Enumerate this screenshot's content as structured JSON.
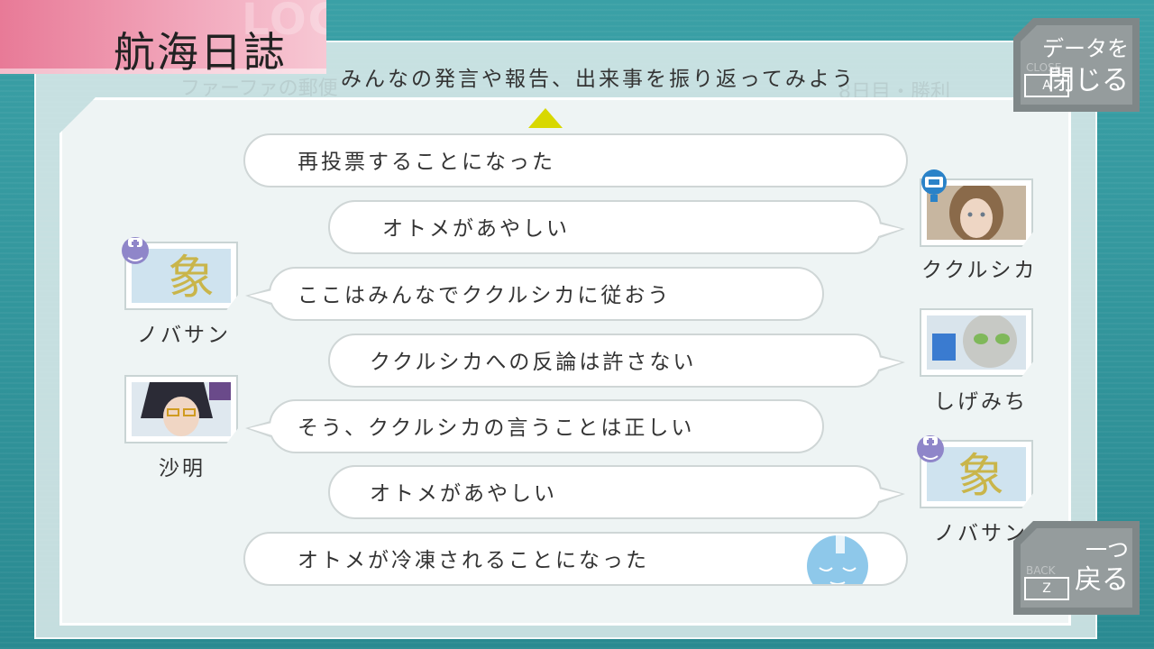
{
  "header": {
    "title": "航海日誌",
    "logo_ghost": "LOG",
    "subtitle": "みんなの発言や報告、出来事を振り返ってみよう"
  },
  "close_button": {
    "label_line1": "データを",
    "label_line2": "閉じる",
    "ghost": "CLOSE",
    "key": "A"
  },
  "back_button": {
    "label_line1": "一つ",
    "label_line2": "戻る",
    "ghost": "BACK",
    "key": "Z"
  },
  "log": [
    {
      "text": "再投票することになった",
      "type": "event"
    },
    {
      "text": "オトメがあやしい",
      "speaker": "ククルシカ",
      "side": "right"
    },
    {
      "text": "ここはみんなでククルシカに従おう",
      "speaker": "ノバサン",
      "side": "left"
    },
    {
      "text": "ククルシカへの反論は許さない",
      "speaker": "しげみち",
      "side": "right"
    },
    {
      "text": "そう、ククルシカの言うことは正しい",
      "speaker": "沙明",
      "side": "left"
    },
    {
      "text": "オトメがあやしい",
      "speaker": "ノバサン",
      "side": "right"
    },
    {
      "text": "オトメが冷凍されることになった",
      "type": "event"
    }
  ],
  "colors": {
    "accent_pink": "#e87a97",
    "teal": "#2e8f95",
    "scroll_arrow": "#d8d800"
  }
}
